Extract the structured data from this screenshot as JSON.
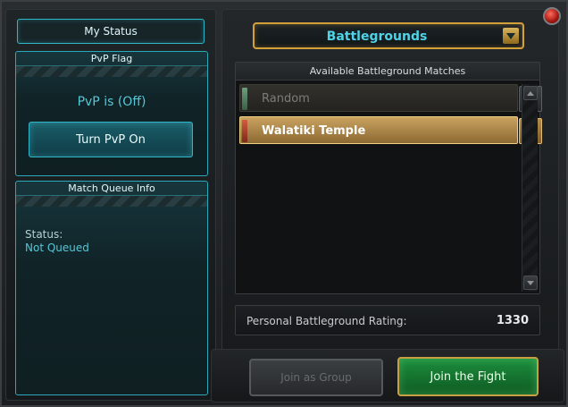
{
  "left": {
    "my_status": "My Status",
    "pvp_flag": {
      "header": "PvP Flag",
      "status": "PvP is (Off)",
      "button": "Turn PvP On"
    },
    "queue": {
      "header": "Match Queue Info",
      "status_label": "Status:",
      "status_value": "Not Queued"
    }
  },
  "right": {
    "dropdown_label": "Battlegrounds",
    "list_title": "Available Battleground Matches",
    "matches": [
      {
        "name": "Random",
        "help": "?"
      },
      {
        "name": "Walatiki Temple",
        "help": "?"
      }
    ],
    "rating_label": "Personal Battleground Rating:",
    "rating_value": "1330"
  },
  "bottom": {
    "join_group": "Join as Group",
    "join_fight": "Join the Fight"
  },
  "colors": {
    "accent_cyan": "#2fb6c9",
    "gold": "#d3a13a",
    "green_button": "#1b8e3d",
    "selected_row": "#caa260"
  }
}
